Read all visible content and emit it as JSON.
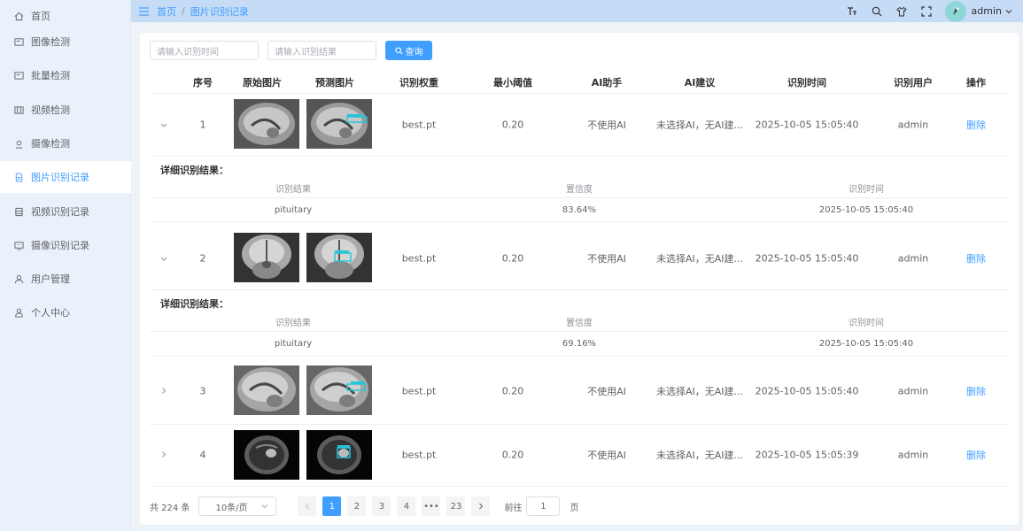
{
  "sidebar": {
    "items": [
      {
        "label": "首页",
        "icon": "home-icon"
      },
      {
        "label": "图像检测",
        "icon": "image-icon"
      },
      {
        "label": "批量检测",
        "icon": "batch-icon"
      },
      {
        "label": "视频检测",
        "icon": "video-icon"
      },
      {
        "label": "摄像检测",
        "icon": "camera-icon"
      },
      {
        "label": "图片识别记录",
        "icon": "document-icon"
      },
      {
        "label": "视频识别记录",
        "icon": "database-icon"
      },
      {
        "label": "摄像识别记录",
        "icon": "monitor-icon"
      },
      {
        "label": "用户管理",
        "icon": "user-icon"
      },
      {
        "label": "个人中心",
        "icon": "profile-icon"
      }
    ],
    "active_index": 5
  },
  "header": {
    "breadcrumb_home": "首页",
    "breadcrumb_sep": "/",
    "breadcrumb_current": "图片识别记录",
    "user": "admin"
  },
  "search": {
    "time_placeholder": "请输入识别时间",
    "result_placeholder": "请输入识别结果",
    "query_label": "查询"
  },
  "table": {
    "columns": [
      "序号",
      "原始图片",
      "预测图片",
      "识别权重",
      "最小阈值",
      "AI助手",
      "AI建议",
      "识别时间",
      "识别用户",
      "操作"
    ],
    "rows": [
      {
        "index": "1",
        "weight": "best.pt",
        "threshold": "0.20",
        "ai_assistant": "不使用AI",
        "ai_advice": "未选择AI，无AI建...",
        "time": "2025-10-05 15:05:40",
        "user": "admin",
        "action": "删除",
        "expanded": true
      },
      {
        "index": "2",
        "weight": "best.pt",
        "threshold": "0.20",
        "ai_assistant": "不使用AI",
        "ai_advice": "未选择AI，无AI建...",
        "time": "2025-10-05 15:05:40",
        "user": "admin",
        "action": "删除",
        "expanded": true
      },
      {
        "index": "3",
        "weight": "best.pt",
        "threshold": "0.20",
        "ai_assistant": "不使用AI",
        "ai_advice": "未选择AI，无AI建...",
        "time": "2025-10-05 15:05:40",
        "user": "admin",
        "action": "删除",
        "expanded": false
      },
      {
        "index": "4",
        "weight": "best.pt",
        "threshold": "0.20",
        "ai_assistant": "不使用AI",
        "ai_advice": "未选择AI，无AI建...",
        "time": "2025-10-05 15:05:39",
        "user": "admin",
        "action": "删除",
        "expanded": false
      }
    ]
  },
  "details": [
    {
      "title": "详细识别结果：",
      "headers": [
        "识别结果",
        "置信度",
        "识别时间"
      ],
      "result": "pituitary",
      "confidence": "83.64%",
      "time": "2025-10-05 15:05:40"
    },
    {
      "title": "详细识别结果：",
      "headers": [
        "识别结果",
        "置信度",
        "识别时间"
      ],
      "result": "pituitary",
      "confidence": "69.16%",
      "time": "2025-10-05 15:05:40"
    }
  ],
  "pagination": {
    "total": "共 224 条",
    "page_size": "10条/页",
    "pages": [
      "1",
      "2",
      "3",
      "4",
      "•••",
      "23"
    ],
    "current": "1",
    "goto_label": "前往",
    "goto_value": "1",
    "page_suffix": "页"
  },
  "colors": {
    "accent": "#409eff",
    "sidebar_bg": "#e9f1fa",
    "header_bg": "#c6dcf6",
    "box": "#26c6da"
  }
}
